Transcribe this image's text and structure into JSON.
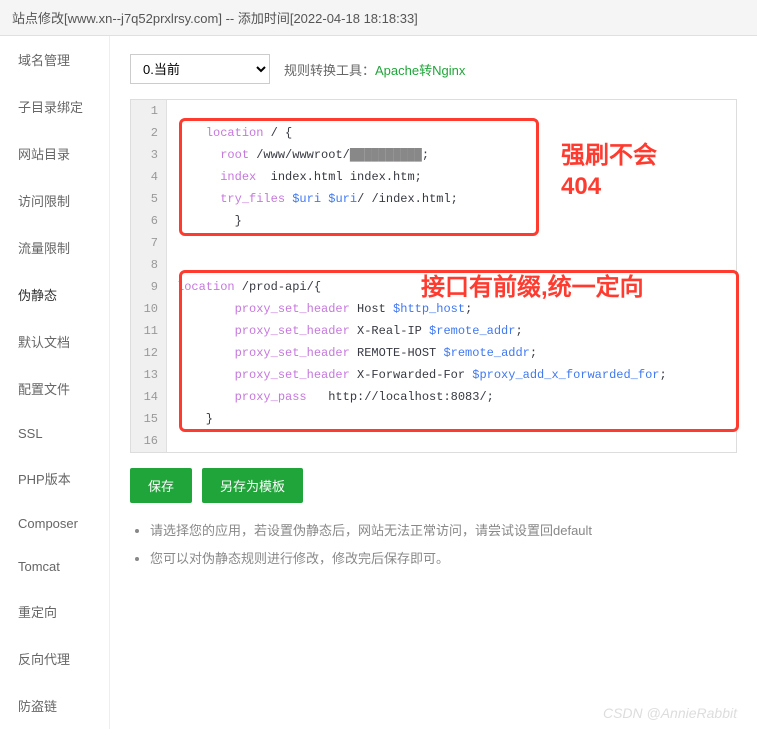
{
  "header": {
    "title": "站点修改[www.xn--j7q52prxlrsy.com] -- 添加时间[2022-04-18 18:18:33]"
  },
  "sidebar": {
    "items": [
      {
        "label": "域名管理"
      },
      {
        "label": "子目录绑定"
      },
      {
        "label": "网站目录"
      },
      {
        "label": "访问限制"
      },
      {
        "label": "流量限制"
      },
      {
        "label": "伪静态"
      },
      {
        "label": "默认文档"
      },
      {
        "label": "配置文件"
      },
      {
        "label": "SSL"
      },
      {
        "label": "PHP版本"
      },
      {
        "label": "Composer"
      },
      {
        "label": "Tomcat"
      },
      {
        "label": "重定向"
      },
      {
        "label": "反向代理"
      },
      {
        "label": "防盗链"
      }
    ],
    "active_index": 5
  },
  "toolbar": {
    "select_value": "0.当前",
    "label": "规则转换工具：",
    "link_text": "Apache转Nginx"
  },
  "code": {
    "lines": [
      {
        "n": 1,
        "tokens": []
      },
      {
        "n": 2,
        "tokens": [
          {
            "t": "    ",
            "c": "plain"
          },
          {
            "t": "location",
            "c": "kw"
          },
          {
            "t": " / {",
            "c": "plain"
          }
        ]
      },
      {
        "n": 3,
        "tokens": [
          {
            "t": "      ",
            "c": "plain"
          },
          {
            "t": "root",
            "c": "kw"
          },
          {
            "t": " /www/wwwroot/",
            "c": "plain"
          },
          {
            "t": "██████████",
            "c": "path"
          },
          {
            "t": ";",
            "c": "plain"
          }
        ]
      },
      {
        "n": 4,
        "tokens": [
          {
            "t": "      ",
            "c": "plain"
          },
          {
            "t": "index",
            "c": "kw"
          },
          {
            "t": "  index.html index.htm;",
            "c": "plain"
          }
        ]
      },
      {
        "n": 5,
        "tokens": [
          {
            "t": "      ",
            "c": "plain"
          },
          {
            "t": "try_files",
            "c": "kw"
          },
          {
            "t": " ",
            "c": "plain"
          },
          {
            "t": "$uri",
            "c": "var"
          },
          {
            "t": " ",
            "c": "plain"
          },
          {
            "t": "$uri",
            "c": "var"
          },
          {
            "t": "/ /index.html;",
            "c": "plain"
          }
        ]
      },
      {
        "n": 6,
        "tokens": [
          {
            "t": "        }",
            "c": "plain"
          }
        ]
      },
      {
        "n": 7,
        "tokens": []
      },
      {
        "n": 8,
        "tokens": []
      },
      {
        "n": 9,
        "tokens": [
          {
            "t": "location",
            "c": "kw"
          },
          {
            "t": " /prod-api/{",
            "c": "plain"
          }
        ]
      },
      {
        "n": 10,
        "tokens": [
          {
            "t": "        ",
            "c": "plain"
          },
          {
            "t": "proxy_set_header",
            "c": "kw"
          },
          {
            "t": " Host ",
            "c": "plain"
          },
          {
            "t": "$http_host",
            "c": "var"
          },
          {
            "t": ";",
            "c": "plain"
          }
        ]
      },
      {
        "n": 11,
        "tokens": [
          {
            "t": "        ",
            "c": "plain"
          },
          {
            "t": "proxy_set_header",
            "c": "kw"
          },
          {
            "t": " X-Real-IP ",
            "c": "plain"
          },
          {
            "t": "$remote_addr",
            "c": "var"
          },
          {
            "t": ";",
            "c": "plain"
          }
        ]
      },
      {
        "n": 12,
        "tokens": [
          {
            "t": "        ",
            "c": "plain"
          },
          {
            "t": "proxy_set_header",
            "c": "kw"
          },
          {
            "t": " REMOTE-HOST ",
            "c": "plain"
          },
          {
            "t": "$remote_addr",
            "c": "var"
          },
          {
            "t": ";",
            "c": "plain"
          }
        ]
      },
      {
        "n": 13,
        "tokens": [
          {
            "t": "        ",
            "c": "plain"
          },
          {
            "t": "proxy_set_header",
            "c": "kw"
          },
          {
            "t": " X-Forwarded-For ",
            "c": "plain"
          },
          {
            "t": "$proxy_add_x_forwarded_for",
            "c": "var"
          },
          {
            "t": ";",
            "c": "plain"
          }
        ]
      },
      {
        "n": 14,
        "tokens": [
          {
            "t": "        ",
            "c": "plain"
          },
          {
            "t": "proxy_pass",
            "c": "kw"
          },
          {
            "t": "   http://localhost:8083/;",
            "c": "plain"
          }
        ]
      },
      {
        "n": 15,
        "tokens": [
          {
            "t": "    }",
            "c": "plain"
          }
        ]
      },
      {
        "n": 16,
        "tokens": []
      }
    ]
  },
  "buttons": {
    "save": "保存",
    "save_as": "另存为模板"
  },
  "tips": {
    "items": [
      "请选择您的应用，若设置伪静态后，网站无法正常访问，请尝试设置回default",
      "您可以对伪静态规则进行修改，修改完后保存即可。"
    ]
  },
  "annotations": {
    "box1_text": "强刷不会404",
    "box2_text": "接口有前缀,统一定向"
  },
  "watermark": "CSDN @AnnieRabbit"
}
